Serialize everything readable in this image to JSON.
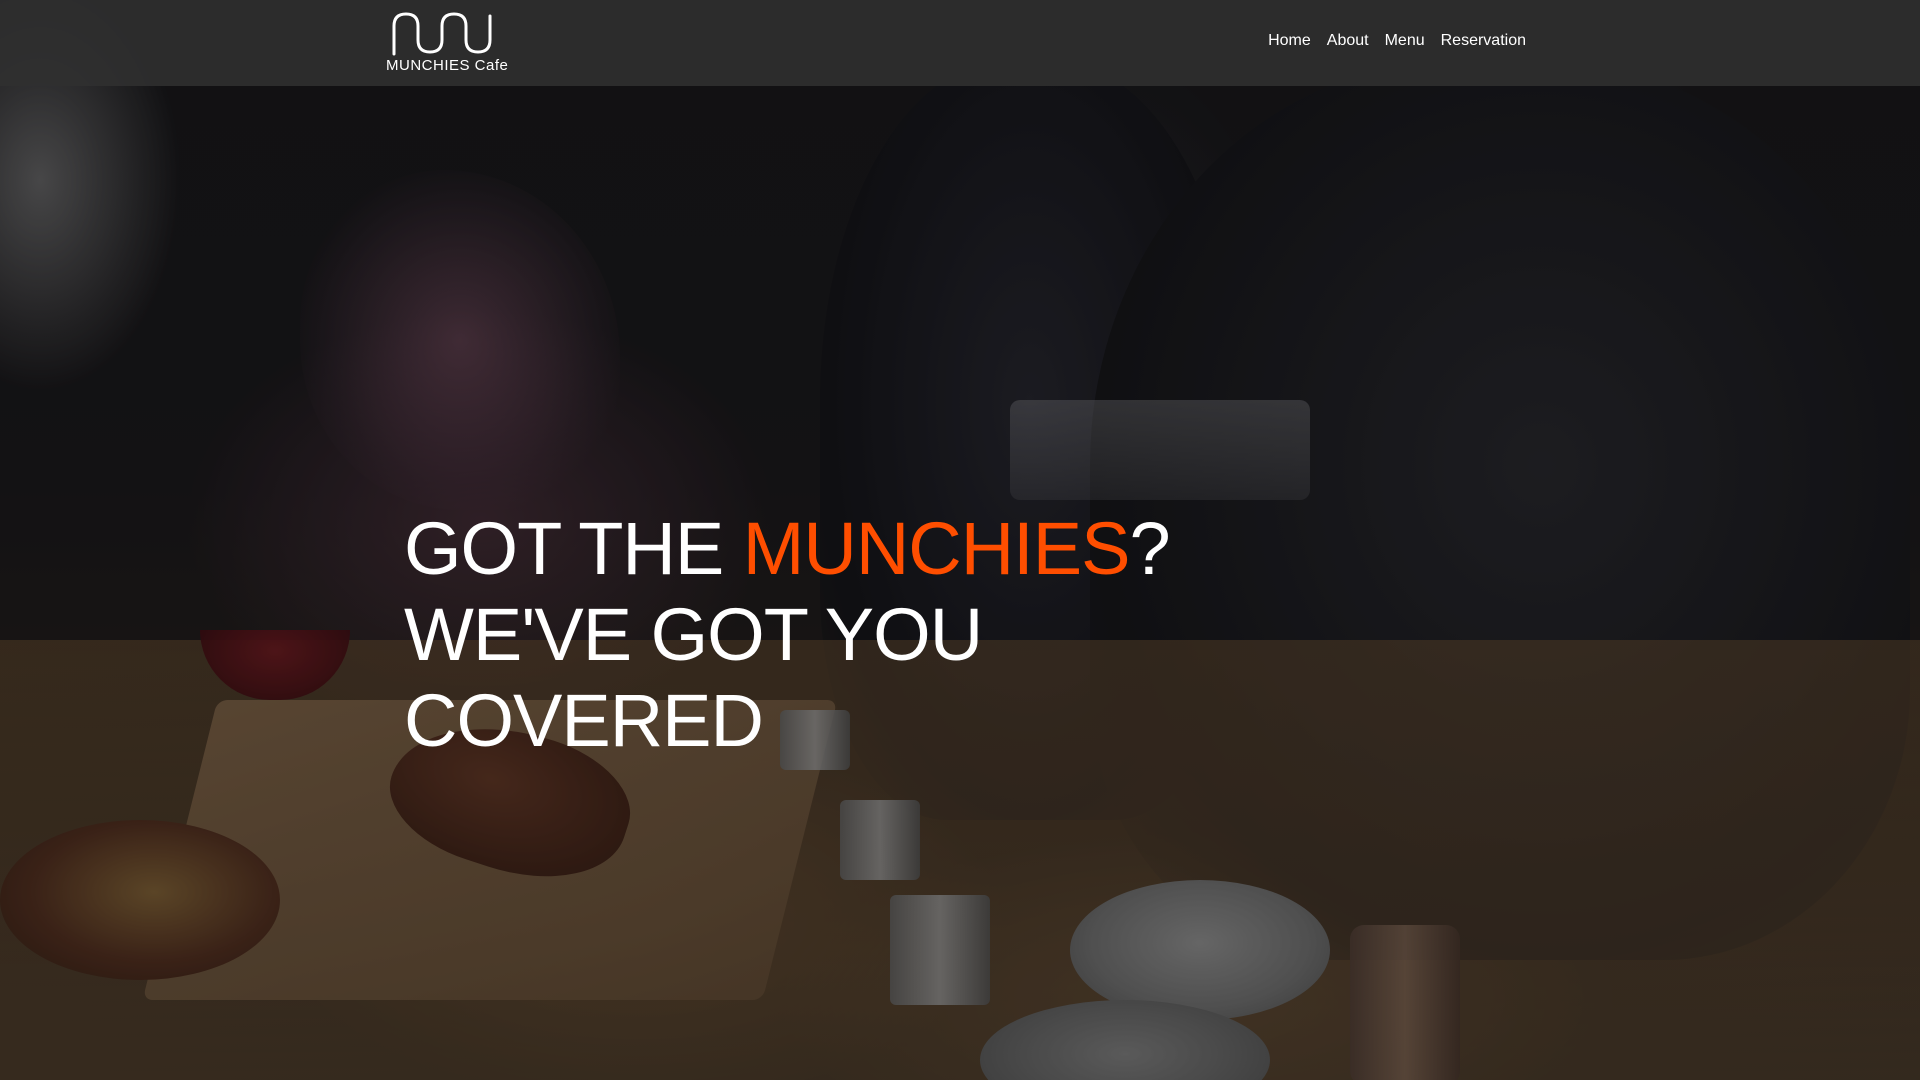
{
  "brand": {
    "logo_text": "MUNCHIES Cafe",
    "accent_color": "#ff4e00"
  },
  "nav": {
    "items": [
      "Home",
      "About",
      "Menu",
      "Reservation"
    ]
  },
  "hero": {
    "line1_prefix": "GOT THE ",
    "line1_highlight": "MUNCHIES",
    "line1_suffix": "?",
    "line2": "WE'VE GOT YOU",
    "line3": "COVERED"
  }
}
